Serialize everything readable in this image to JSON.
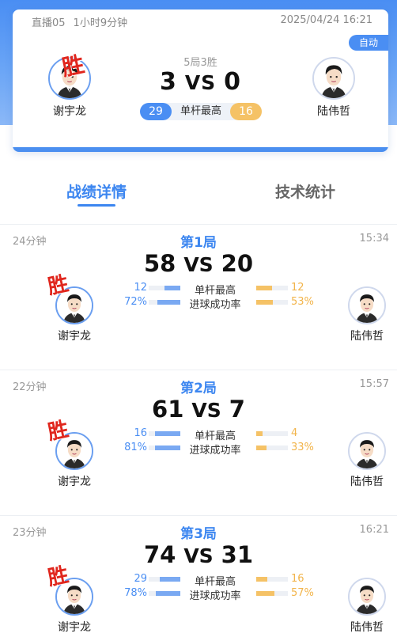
{
  "colors": {
    "accent": "#3c86f0",
    "left_player": "#4a8ef3",
    "right_player": "#f5c266",
    "win_stamp": "#e0261d"
  },
  "match": {
    "channel": "直播05",
    "duration": "1小时9分钟",
    "datetime": "2025/04/24 16:21",
    "auto_label": "自动",
    "format": "5局3胜",
    "score_left": "3",
    "vs": "VS",
    "score_right": "0",
    "high_break_label": "单杆最高",
    "high_break_left": "29",
    "high_break_right": "16",
    "win_stamp": "胜",
    "player_left": "谢宇龙",
    "player_right": "陆伟哲"
  },
  "tabs": [
    {
      "label": "战绩详情",
      "active": true
    },
    {
      "label": "技术统计",
      "active": false
    }
  ],
  "games": [
    {
      "duration": "24分钟",
      "title": "第1局",
      "time": "15:34",
      "score_left": "58",
      "vs": "VS",
      "score_right": "20",
      "stats": [
        {
          "label": "单杆最高",
          "left": "12",
          "right": "12",
          "left_frac": 0.5,
          "right_frac": 0.5
        },
        {
          "label": "进球成功率",
          "left": "72%",
          "right": "53%",
          "left_frac": 0.72,
          "right_frac": 0.53
        }
      ],
      "win_stamp": "胜",
      "player_left": "谢宇龙",
      "player_right": "陆伟哲"
    },
    {
      "duration": "22分钟",
      "title": "第2局",
      "time": "15:57",
      "score_left": "61",
      "vs": "VS",
      "score_right": "7",
      "stats": [
        {
          "label": "单杆最高",
          "left": "16",
          "right": "4",
          "left_frac": 0.8,
          "right_frac": 0.2
        },
        {
          "label": "进球成功率",
          "left": "81%",
          "right": "33%",
          "left_frac": 0.81,
          "right_frac": 0.33
        }
      ],
      "win_stamp": "胜",
      "player_left": "谢宇龙",
      "player_right": "陆伟哲"
    },
    {
      "duration": "23分钟",
      "title": "第3局",
      "time": "16:21",
      "score_left": "74",
      "vs": "VS",
      "score_right": "31",
      "stats": [
        {
          "label": "单杆最高",
          "left": "29",
          "right": "16",
          "left_frac": 0.64,
          "right_frac": 0.36
        },
        {
          "label": "进球成功率",
          "left": "78%",
          "right": "57%",
          "left_frac": 0.78,
          "right_frac": 0.57
        }
      ],
      "win_stamp": "胜",
      "player_left": "谢宇龙",
      "player_right": "陆伟哲"
    }
  ]
}
